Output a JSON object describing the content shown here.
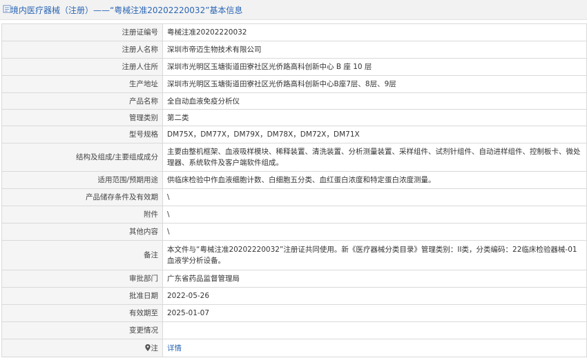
{
  "header": {
    "title": "境内医疗器械（注册）——“粤械注准20202220032”基本信息"
  },
  "rows": [
    {
      "label": "注册证编号",
      "value": "粤械注准20202220032"
    },
    {
      "label": "注册人名称",
      "value": "深圳市帝迈生物技术有限公司"
    },
    {
      "label": "注册人住所",
      "value": "深圳市光明区玉塘街道田寮社区光侨路高科创新中心 B 座 10 层"
    },
    {
      "label": "生产地址",
      "value": "深圳市光明区玉塘街道田寮社区光侨路高科创新中心B座7层、8层、9层"
    },
    {
      "label": "产品名称",
      "value": "全自动血液免疫分析仪"
    },
    {
      "label": "管理类别",
      "value": "第二类"
    },
    {
      "label": "型号规格",
      "value": "DM75X，DM77X，DM79X，DM78X，DM72X，DM71X"
    },
    {
      "label": "结构及组成/主要组成成分",
      "value": "主要由整机框架、血液吸样模块、稀释装置、清洗装置、分析测量装置、采样组件、试剂针组件、自动进样组件、控制板卡、微处理器、系统软件及客户端软件组成。"
    },
    {
      "label": "适用范围/预期用途",
      "value": "供临床检验中作血液细胞计数、白细胞五分类、血红蛋白浓度和特定蛋白浓度测量。"
    },
    {
      "label": "产品储存条件及有效期",
      "value": "\\"
    },
    {
      "label": "附件",
      "value": "\\"
    },
    {
      "label": "其他内容",
      "value": "\\"
    },
    {
      "label": "备注",
      "value": "本文件与“粤械注准20202220032”注册证共同使用。新《医疗器械分类目录》管理类别：II类，分类编码：22临床检验器械-01血液学分析设备。"
    },
    {
      "label": "审批部门",
      "value": "广东省药品监督管理局"
    },
    {
      "label": "批准日期",
      "value": "2022-05-26"
    },
    {
      "label": "有效期至",
      "value": "2025-01-07"
    },
    {
      "label": "变更情况",
      "value": ""
    }
  ],
  "note_row": {
    "label": "注",
    "link": "详情",
    "icon": "location-pin-icon"
  }
}
